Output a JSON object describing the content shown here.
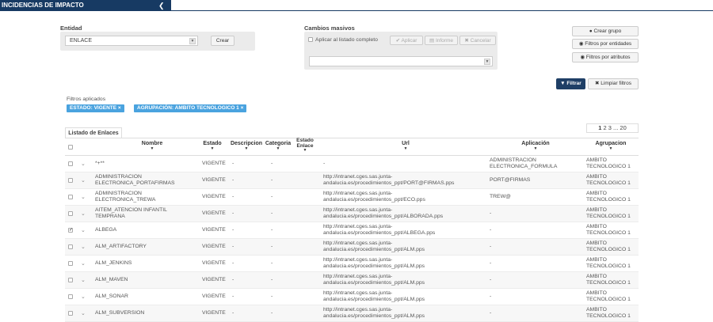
{
  "header": {
    "title": "INCIDENCIAS DE IMPACTO",
    "back_icon": "chevron-left-icon"
  },
  "entidad": {
    "label": "Entidad",
    "selected": "ENLACE",
    "create_label": "Crear"
  },
  "cambios": {
    "label": "Cambios masivos",
    "apply_all_label": "Aplicar al listado completo",
    "apply_label": "Aplicar",
    "report_label": "Informe",
    "cancel_label": "Cancelar",
    "select_value": ""
  },
  "side_buttons": {
    "create_group": "Crear grupo",
    "filter_entities": "Filtros por entidades",
    "filter_attributes": "Filtros por atributos"
  },
  "filter_actions": {
    "filter_label": "Filtrar",
    "clear_label": "Limpiar filtros"
  },
  "applied_filters": {
    "label": "Filtros aplicados",
    "chips": [
      "ESTADO: VIGENTE ×",
      "AGRUPACIÓN: AMBITO TECNOLOGICO 1 ×"
    ]
  },
  "table": {
    "tab_label": "Listado de Enlaces",
    "pagination": {
      "current": "1",
      "p2": "2",
      "p3": "3",
      "ellipsis": "...",
      "last": "20"
    },
    "columns": {
      "nombre": "Nombre",
      "estado": "Estado",
      "descripcion": "Descripcion",
      "categoria": "Categoria",
      "estado_enlace": "Estado Enlace",
      "url": "Url",
      "aplicacion": "Aplicación",
      "agrupacion": "Agrupacion"
    },
    "rows": [
      {
        "nombre": "*+**",
        "estado": "VIGENTE",
        "desc": "-",
        "cat": "-",
        "url": "-",
        "app": "ADMINISTRACION ELECTRONICA_FORMULA",
        "grp": "AMBITO TECNOLOGICO 1",
        "checked": false
      },
      {
        "nombre": "ADMINISTRACION ELECTRONICA_PORTAFIRMAS",
        "estado": "VIGENTE",
        "desc": "-",
        "cat": "-",
        "url": "http://intranet.cges.sas.junta-andalucia.es/procedimientos_ppt/PORT@FIRMAS.pps",
        "app": "PORT@FIRMAS",
        "grp": "AMBITO TECNOLOGICO 1",
        "checked": false
      },
      {
        "nombre": "ADMINISTRACION ELECTRONICA_TREWA",
        "estado": "VIGENTE",
        "desc": "-",
        "cat": "-",
        "url": "http://intranet.cges.sas.junta-andalucia.es/procedimientos_ppt/ECO.pps",
        "app": "TREW@",
        "grp": "AMBITO TECNOLOGICO 1",
        "checked": false
      },
      {
        "nombre": "AITEM_ATENCION INFANTIL TEMPRANA",
        "estado": "VIGENTE",
        "desc": "-",
        "cat": "-",
        "url": "http://intranet.cges.sas.junta-andalucia.es/procedimientos_ppt/ALBORADA.pps",
        "app": "-",
        "grp": "AMBITO TECNOLOGICO 1",
        "checked": false
      },
      {
        "nombre": "ALBEGA",
        "estado": "VIGENTE",
        "desc": "-",
        "cat": "-",
        "url": "http://intranet.cges.sas.junta-andalucia.es/procedimientos_ppt/ALBEGA.pps",
        "app": "-",
        "grp": "AMBITO TECNOLOGICO 1",
        "checked": true
      },
      {
        "nombre": "ALM_ARTIFACTORY",
        "estado": "VIGENTE",
        "desc": "-",
        "cat": "-",
        "url": "http://intranet.cges.sas.junta-andalucia.es/procedimientos_ppt/ALM.pps",
        "app": "-",
        "grp": "AMBITO TECNOLOGICO 1",
        "checked": false
      },
      {
        "nombre": "ALM_JENKINS",
        "estado": "VIGENTE",
        "desc": "-",
        "cat": "-",
        "url": "http://intranet.cges.sas.junta-andalucia.es/procedimientos_ppt/ALM.pps",
        "app": "-",
        "grp": "AMBITO TECNOLOGICO 1",
        "checked": false
      },
      {
        "nombre": "ALM_MAVEN",
        "estado": "VIGENTE",
        "desc": "-",
        "cat": "-",
        "url": "http://intranet.cges.sas.junta-andalucia.es/procedimientos_ppt/ALM.pps",
        "app": "-",
        "grp": "AMBITO TECNOLOGICO 1",
        "checked": false
      },
      {
        "nombre": "ALM_SONAR",
        "estado": "VIGENTE",
        "desc": "-",
        "cat": "-",
        "url": "http://intranet.cges.sas.junta-andalucia.es/procedimientos_ppt/ALM.pps",
        "app": "-",
        "grp": "AMBITO TECNOLOGICO 1",
        "checked": false
      },
      {
        "nombre": "ALM_SUBVERSION",
        "estado": "VIGENTE",
        "desc": "-",
        "cat": "-",
        "url": "http://intranet.cges.sas.junta-andalucia.es/procedimientos_ppt/ALM.pps",
        "app": "-",
        "grp": "AMBITO TECNOLOGICO 1",
        "checked": false
      }
    ]
  }
}
